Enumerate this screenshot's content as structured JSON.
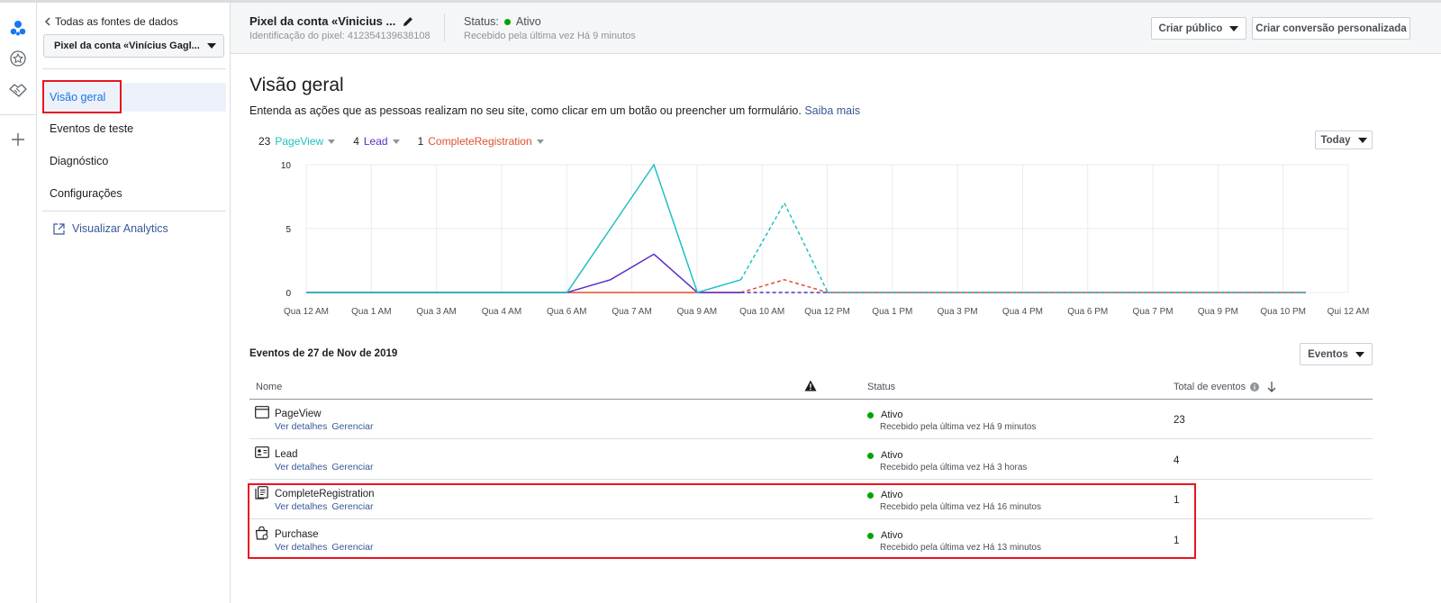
{
  "sidebar": {
    "back_label": "Todas as fontes de dados",
    "pixel_select": "Pixel da conta «Vinícius Gagl...",
    "nav": [
      {
        "label": "Visão geral"
      },
      {
        "label": "Eventos de teste"
      },
      {
        "label": "Diagnóstico"
      },
      {
        "label": "Configurações"
      }
    ],
    "analytics_label": "Visualizar Analytics"
  },
  "header": {
    "title": "Pixel da conta «Vinicius ...",
    "pixel_id": "Identificação do pixel: 412354139638108",
    "status_prefix": "Status:",
    "status_value": "Ativo",
    "received": "Recebido pela última vez Há 9 minutos",
    "btn_audience": "Criar público",
    "btn_conversion": "Criar conversão personalizada"
  },
  "main": {
    "title": "Visão geral",
    "description": "Entenda as ações que as pessoas realizam no seu site, como clicar em um botão ou preencher um formulário.",
    "learn_more": "Saiba mais",
    "range_select": "Today",
    "events_title": "Eventos de 27 de Nov de 2019",
    "events_select": "Eventos"
  },
  "colors": {
    "pageview": "#1fc1c1",
    "lead": "#5b2cc6",
    "complete": "#e0502b",
    "annotation": "#e8141f"
  },
  "chart_data": {
    "type": "line",
    "x": [
      "Qua 12 AM",
      "Qua 1 AM",
      "Qua 3 AM",
      "Qua 4 AM",
      "Qua 6 AM",
      "Qua 7 AM",
      "Qua 9 AM",
      "Qua 10 AM",
      "Qua 12 PM",
      "Qua 1 PM",
      "Qua 3 PM",
      "Qua 4 PM",
      "Qua 6 PM",
      "Qua 7 PM",
      "Qua 9 PM",
      "Qua 10 PM",
      "Qui 12 AM"
    ],
    "y_ticks": [
      0,
      5,
      10
    ],
    "ylim": [
      0,
      10
    ],
    "series": [
      {
        "name": "PageView",
        "count": "23",
        "color": "#1fc1c1",
        "values": [
          0,
          0,
          0,
          0,
          0,
          0,
          0,
          5,
          10,
          0,
          1,
          7,
          0,
          0,
          0,
          0,
          0,
          0,
          0,
          0,
          0,
          0,
          0,
          0,
          0
        ]
      },
      {
        "name": "Lead",
        "count": "4",
        "color": "#5b2cc6",
        "values": [
          0,
          0,
          0,
          0,
          0,
          0,
          0,
          1,
          3,
          0,
          0,
          0,
          0,
          0,
          0,
          0,
          0,
          0,
          0,
          0,
          0,
          0,
          0,
          0,
          0
        ]
      },
      {
        "name": "CompleteRegistration",
        "count": "1",
        "color": "#e0502b",
        "values": [
          0,
          0,
          0,
          0,
          0,
          0,
          0,
          0,
          0,
          0,
          0,
          1,
          0,
          0,
          0,
          0,
          0,
          0,
          0,
          0,
          0,
          0,
          0,
          0,
          0
        ]
      }
    ],
    "solid_until_index": 10
  },
  "table": {
    "headers": {
      "name": "Nome",
      "status": "Status",
      "total": "Total de eventos"
    },
    "link_details": "Ver detalhes",
    "link_manage": "Gerenciar",
    "rows": [
      {
        "name": "PageView",
        "status": "Ativo",
        "received": "Recebido pela última vez Há 9 minutos",
        "total": "23",
        "icon": "browser-window-icon"
      },
      {
        "name": "Lead",
        "status": "Ativo",
        "received": "Recebido pela última vez Há 3 horas",
        "total": "4",
        "icon": "id-card-icon"
      },
      {
        "name": "CompleteRegistration",
        "status": "Ativo",
        "received": "Recebido pela última vez Há 16 minutos",
        "total": "1",
        "icon": "form-checklist-icon"
      },
      {
        "name": "Purchase",
        "status": "Ativo",
        "received": "Recebido pela última vez Há 13 minutos",
        "total": "1",
        "icon": "shopping-bag-icon"
      }
    ]
  }
}
